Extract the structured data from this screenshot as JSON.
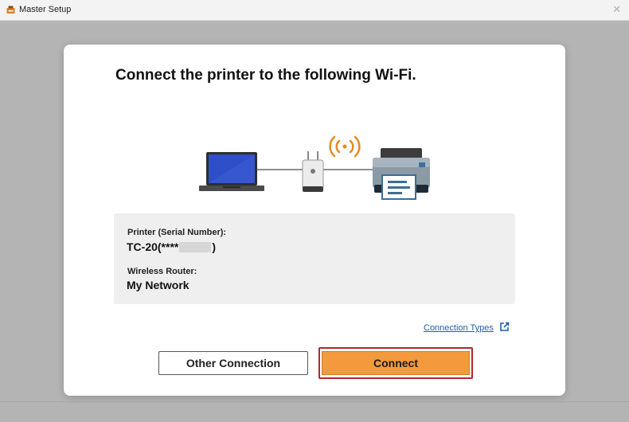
{
  "window": {
    "title": "Master Setup",
    "close_glyph": "✕"
  },
  "dialog": {
    "heading": "Connect the printer to the following Wi-Fi.",
    "illustration_icons": [
      "laptop-icon",
      "wireless-router-icon",
      "wifi-signal-icon",
      "printer-icon"
    ],
    "printer_label": "Printer (Serial Number):",
    "printer_value_prefix": "TC-20(****",
    "printer_value_suffix": ")",
    "router_label": "Wireless Router:",
    "router_value": "My Network",
    "link_label": "Connection Types",
    "other_button_label": "Other Connection",
    "connect_button_label": "Connect"
  },
  "colors": {
    "accent": "#f39a3c",
    "highlight_border": "#b3262b",
    "link": "#1a5fb4",
    "wifi_signal": "#e8891c",
    "laptop_screen": "#2f4fc8"
  }
}
